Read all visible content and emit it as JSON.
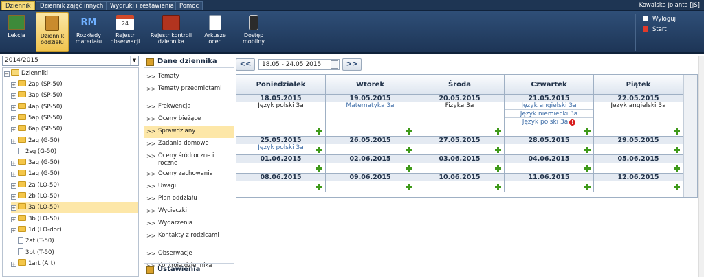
{
  "menu": {
    "tabs": [
      "Dziennik",
      "Dziennik zajęć innych",
      "Wydruki i zestawienia",
      "Pomoc"
    ],
    "active_index": 0,
    "user": "Kowalska Jolanta [JS]"
  },
  "ribbon": {
    "buttons": [
      {
        "label": "Lekcja",
        "icon": "chalkboard-icon"
      },
      {
        "label": "Dziennik oddziału",
        "icon": "class-journal-icon"
      },
      {
        "label": "Rozkłady materiału",
        "icon": "curriculum-rm-icon"
      },
      {
        "label": "Rejestr obserwacji",
        "icon": "observation-calendar-icon"
      },
      {
        "label": "Rejestr kontroli dziennika",
        "icon": "journal-control-icon"
      },
      {
        "label": "Arkusze ocen",
        "icon": "grade-sheet-icon"
      },
      {
        "label": "Dostęp mobilny",
        "icon": "mobile-access-icon"
      }
    ],
    "active_index": 1,
    "side": [
      {
        "label": "Wyloguj",
        "icon": "lock-icon"
      },
      {
        "label": "Start",
        "icon": "home-icon"
      }
    ]
  },
  "tree": {
    "year": "2014/2015",
    "root": "Dzienniki",
    "items": [
      {
        "label": "2ap (SP-50)",
        "type": "folder"
      },
      {
        "label": "3ap (SP-50)",
        "type": "folder"
      },
      {
        "label": "4ap (SP-50)",
        "type": "folder"
      },
      {
        "label": "5ap (SP-50)",
        "type": "folder"
      },
      {
        "label": "6ap (SP-50)",
        "type": "folder"
      },
      {
        "label": "2ag (G-50)",
        "type": "folder"
      },
      {
        "label": "2sg (G-50)",
        "type": "doc"
      },
      {
        "label": "3ag (G-50)",
        "type": "folder"
      },
      {
        "label": "1ag (G-50)",
        "type": "folder"
      },
      {
        "label": "2a (LO-50)",
        "type": "folder"
      },
      {
        "label": "2b (LO-50)",
        "type": "folder"
      },
      {
        "label": "3a (LO-50)",
        "type": "folder"
      },
      {
        "label": "3b (LO-50)",
        "type": "folder"
      },
      {
        "label": "1d (LO-dor)",
        "type": "folder"
      },
      {
        "label": "2at (T-50)",
        "type": "doc"
      },
      {
        "label": "3bt (T-50)",
        "type": "doc"
      },
      {
        "label": "1art (Art)",
        "type": "folder"
      }
    ],
    "selected_index": 11
  },
  "nav": {
    "header": "Dane dziennika",
    "items": [
      "Tematy",
      "Tematy przedmiotami",
      "Frekwencja",
      "Oceny bieżące",
      "Sprawdziany",
      "Zadania domowe",
      "Oceny śródroczne i roczne",
      "Oceny zachowania",
      "Uwagi",
      "Plan oddziału",
      "Wycieczki",
      "Wydarzenia",
      "Kontakty z rodzicami",
      "Obserwacje",
      "Kontrola dziennika"
    ],
    "selected_index": 4,
    "footer": "Ustawienia dziennika"
  },
  "calendar": {
    "prev_label": "<<",
    "next_label": ">>",
    "range": "18.05 - 24.05 2015",
    "days": [
      "Poniedziałek",
      "Wtorek",
      "Środa",
      "Czwartek",
      "Piątek"
    ],
    "weeks": [
      {
        "dates": [
          "18.05.2015",
          "19.05.2015",
          "20.05.2015",
          "21.05.2015",
          "22.05.2015"
        ],
        "entries": [
          [
            {
              "text": "Język polski 3a",
              "style": "dark"
            }
          ],
          [
            {
              "text": "Matematyka 3a",
              "style": "link"
            }
          ],
          [
            {
              "text": "Fizyka 3a",
              "style": "dark"
            }
          ],
          [
            {
              "text": "Język angielski 3a",
              "style": "link"
            },
            {
              "text": "Język niemiecki 3a",
              "style": "link"
            },
            {
              "text": "Język polski 3a",
              "style": "link",
              "warning": "!"
            }
          ],
          [
            {
              "text": "Język angielski 3a",
              "style": "dark"
            }
          ]
        ]
      },
      {
        "dates": [
          "25.05.2015",
          "26.05.2015",
          "27.05.2015",
          "28.05.2015",
          "29.05.2015"
        ],
        "entries": [
          [
            {
              "text": "Język polski 3a",
              "style": "link"
            }
          ],
          [],
          [],
          [],
          []
        ]
      },
      {
        "dates": [
          "01.06.2015",
          "02.06.2015",
          "03.06.2015",
          "04.06.2015",
          "05.06.2015"
        ],
        "entries": [
          [],
          [],
          [],
          [],
          []
        ]
      },
      {
        "dates": [
          "08.06.2015",
          "09.06.2015",
          "10.06.2015",
          "11.06.2015",
          "12.06.2015"
        ],
        "entries": [
          [],
          [],
          [],
          [],
          []
        ]
      }
    ]
  }
}
